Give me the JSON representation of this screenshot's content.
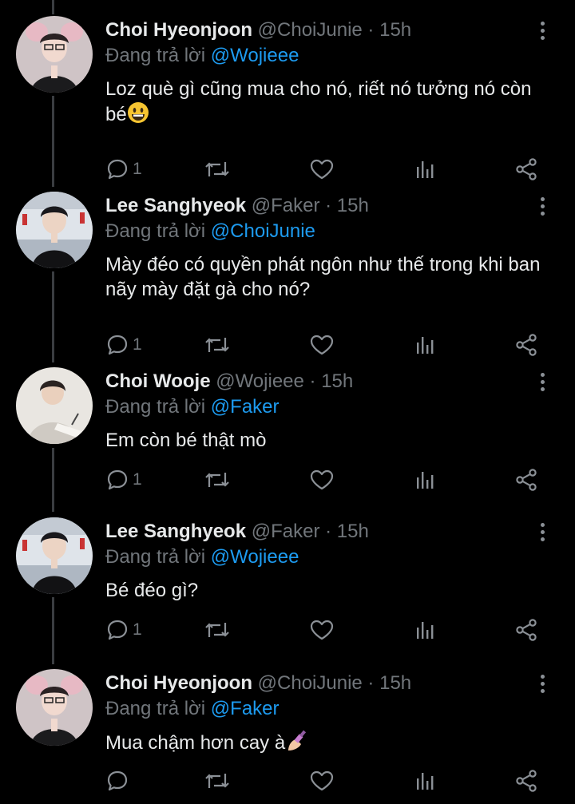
{
  "reply_prefix": "Đang trả lời",
  "colors": {
    "background": "#000000",
    "text": "#e7e9ea",
    "muted": "#71767b",
    "link": "#1d9bf0",
    "thread_line": "#3a3d41"
  },
  "icons": [
    "reply-icon",
    "retweet-icon",
    "like-icon",
    "analytics-icon",
    "share-icon",
    "more-icon"
  ],
  "tweets": [
    {
      "name": "Choi Hyeonjoon",
      "handle": "@ChoiJunie",
      "time": "15h",
      "reply_to": "@Wojieee",
      "text": "Loz què gì cũng mua cho nó, riết nó tưởng nó còn bé",
      "emoji": "grinning-face",
      "reply_count": "1"
    },
    {
      "name": "Lee Sanghyeok",
      "handle": "@Faker",
      "time": "15h",
      "reply_to": "@ChoiJunie",
      "text": "Mày đéo có quyền phát ngôn như thế trong khi ban nãy mày đặt gà cho nó?",
      "reply_count": "1"
    },
    {
      "name": "Choi Wooje",
      "handle": "@Wojieee",
      "time": "15h",
      "reply_to": "@Faker",
      "text": "Em còn bé thật mò",
      "reply_count": "1"
    },
    {
      "name": "Lee Sanghyeok",
      "handle": "@Faker",
      "time": "15h",
      "reply_to": "@Wojieee",
      "text": "Bé đéo gì?",
      "reply_count": "1"
    },
    {
      "name": "Choi Hyeonjoon",
      "handle": "@ChoiJunie",
      "time": "15h",
      "reply_to": "@Faker",
      "text": "Mua chậm hơn cay à",
      "emoji": "nail-polish",
      "reply_count": ""
    }
  ]
}
